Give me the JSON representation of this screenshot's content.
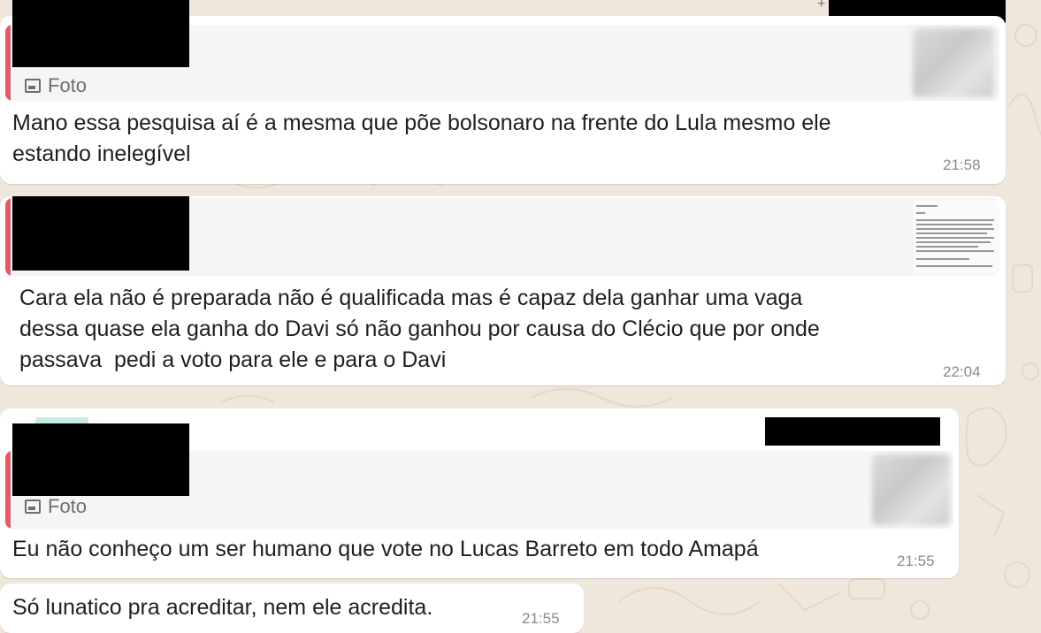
{
  "messages": [
    {
      "quote_label": "Foto",
      "text": "Mano essa pesquisa aí é a mesma que põe bolsonaro na frente do Lula mesmo ele\nestando inelegível",
      "time": "21:58"
    },
    {
      "text": "Cara ela não é preparada não é qualificada mas é capaz dela ganhar uma vaga\ndessa quase ela ganha do Davi só não ganhou por causa do Clécio que por onde\npassava  pedi a voto para ele e para o Davi",
      "time": "22:04"
    },
    {
      "quote_label": "Foto",
      "text": "Eu não conheço um ser humano que vote no Lucas Barreto em todo Amapá",
      "time": "21:55"
    },
    {
      "text": "Só lunatico pra acreditar, nem ele acredita.",
      "time": "21:55"
    }
  ],
  "colors": {
    "quote_bar": "#e15c66",
    "bubble": "#ffffff",
    "wallpaper": "#efe7dc"
  }
}
